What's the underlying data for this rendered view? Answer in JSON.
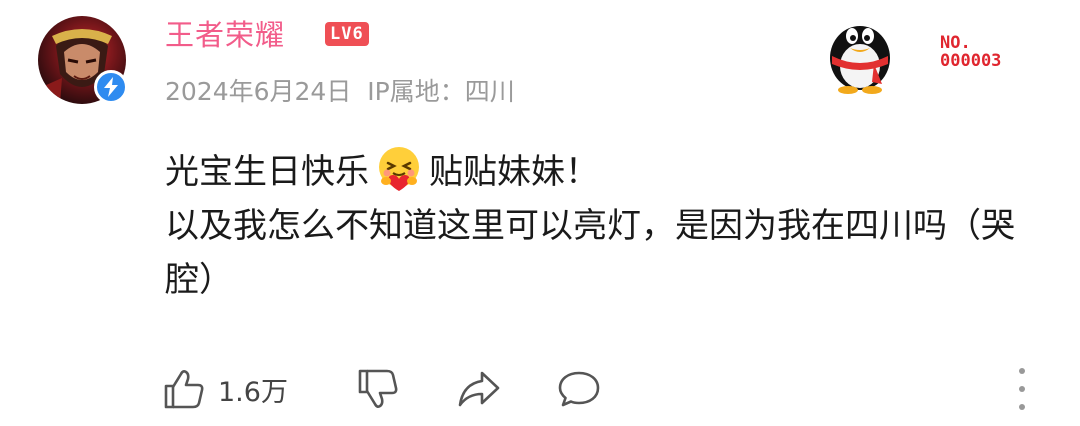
{
  "user": {
    "name": "王者荣耀",
    "level": "LV6",
    "date": "2024年6月24日",
    "ip_label": "IP属地：四川"
  },
  "badge": {
    "no_label": "NO.",
    "number": "000003"
  },
  "comment": {
    "line1_before": "光宝生日快乐",
    "line1_after": "贴贴妹妹！",
    "line2": "以及我怎么不知道这里可以亮灯，是因为我在四川吗（哭腔）"
  },
  "actions": {
    "like_count": "1.6万"
  },
  "colors": {
    "username": "#f25c8a",
    "level_bg": "#ef4f55",
    "verified": "#2e8bf0",
    "badge": "#e0262f"
  }
}
